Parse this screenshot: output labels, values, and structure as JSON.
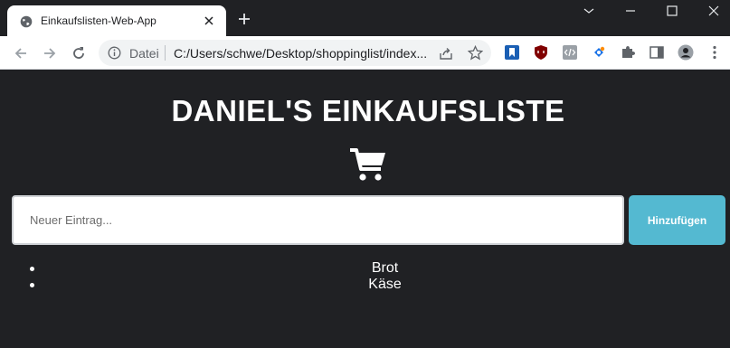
{
  "browser": {
    "tab": {
      "title": "Einkaufslisten-Web-App"
    },
    "address": {
      "scheme_label": "Datei",
      "url": "C:/Users/schwe/Desktop/shoppinglist/index..."
    }
  },
  "page": {
    "heading": "DANIEL'S EINKAUFSLISTE",
    "input": {
      "placeholder": "Neuer Eintrag..."
    },
    "add_button": "Hinzufügen",
    "items": [
      {
        "label": "Brot"
      },
      {
        "label": "Käse"
      }
    ]
  },
  "colors": {
    "background": "#202124",
    "accent_button": "#54b9d1",
    "text": "#ffffff"
  },
  "icons": [
    "globe-icon",
    "close-icon",
    "plus-icon",
    "minimize-icon",
    "maximize-icon",
    "window-close-icon",
    "back-arrow-icon",
    "forward-arrow-icon",
    "reload-icon",
    "info-icon",
    "share-icon",
    "star-icon",
    "extension-icons",
    "puzzle-icon",
    "sidepanel-icon",
    "profile-avatar",
    "more-vert-icon",
    "shopping-cart-icon"
  ]
}
